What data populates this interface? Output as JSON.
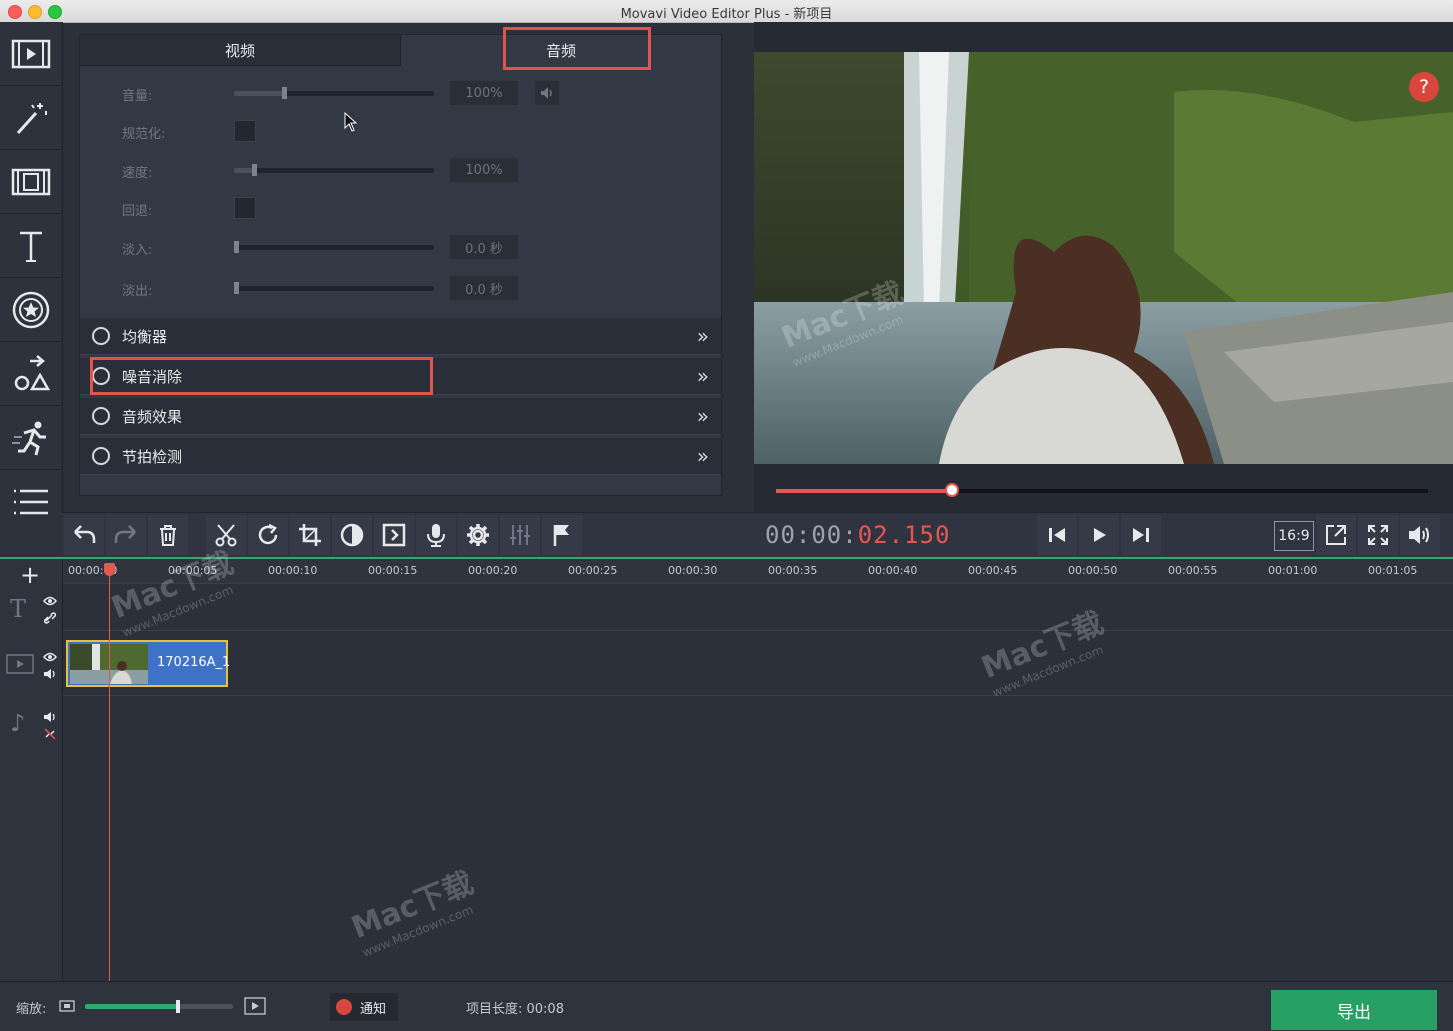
{
  "window": {
    "title": "Movavi Video Editor Plus - 新项目"
  },
  "sidebar": {
    "items": [
      {
        "icon": "film-import-icon"
      },
      {
        "icon": "magic-wand-icon"
      },
      {
        "icon": "transitions-icon"
      },
      {
        "icon": "titles-icon"
      },
      {
        "icon": "stickers-icon"
      },
      {
        "icon": "callouts-icon"
      },
      {
        "icon": "motion-icon"
      },
      {
        "icon": "more-icon"
      }
    ]
  },
  "properties": {
    "tabs": [
      {
        "label": "视频",
        "active": false
      },
      {
        "label": "音频",
        "active": true
      }
    ],
    "volume": {
      "label": "音量:",
      "value": "100%",
      "level": 0.25
    },
    "normalize": {
      "label": "规范化:"
    },
    "speed": {
      "label": "速度:",
      "value": "100%",
      "level": 0.1
    },
    "reverse": {
      "label": "回退:"
    },
    "fade_in": {
      "label": "淡入:",
      "value": "0.0 秒",
      "level": 0
    },
    "fade_out": {
      "label": "淡出:",
      "value": "0.0 秒",
      "level": 0
    },
    "sections": [
      {
        "label": "均衡器"
      },
      {
        "label": "噪音消除"
      },
      {
        "label": "音频效果"
      },
      {
        "label": "节拍检测"
      }
    ]
  },
  "preview": {
    "help": "?",
    "progress": 0.27
  },
  "toolbar": {
    "timecode_prefix": "00:00:",
    "timecode_active": "02.150",
    "aspect": "16:9"
  },
  "timeline": {
    "ticks": [
      "00:00:00",
      "00:00:05",
      "00:00:10",
      "00:00:15",
      "00:00:20",
      "00:00:25",
      "00:00:30",
      "00:00:35",
      "00:00:40",
      "00:00:45",
      "00:00:50",
      "00:00:55",
      "00:01:00",
      "00:01:05"
    ],
    "clip_label": "170216A_1"
  },
  "statusbar": {
    "zoom_label": "缩放:",
    "zoom_level": 0.63,
    "notify": "通知",
    "project_length": "项目长度:  00:08",
    "export": "导出"
  },
  "watermark": {
    "brand": "Mac下载",
    "url": "www.Macdown.com"
  },
  "colors": {
    "accent": "#e8574f",
    "green": "#27a065",
    "clip": "#3d72c8",
    "highlight": "#e2534c"
  }
}
